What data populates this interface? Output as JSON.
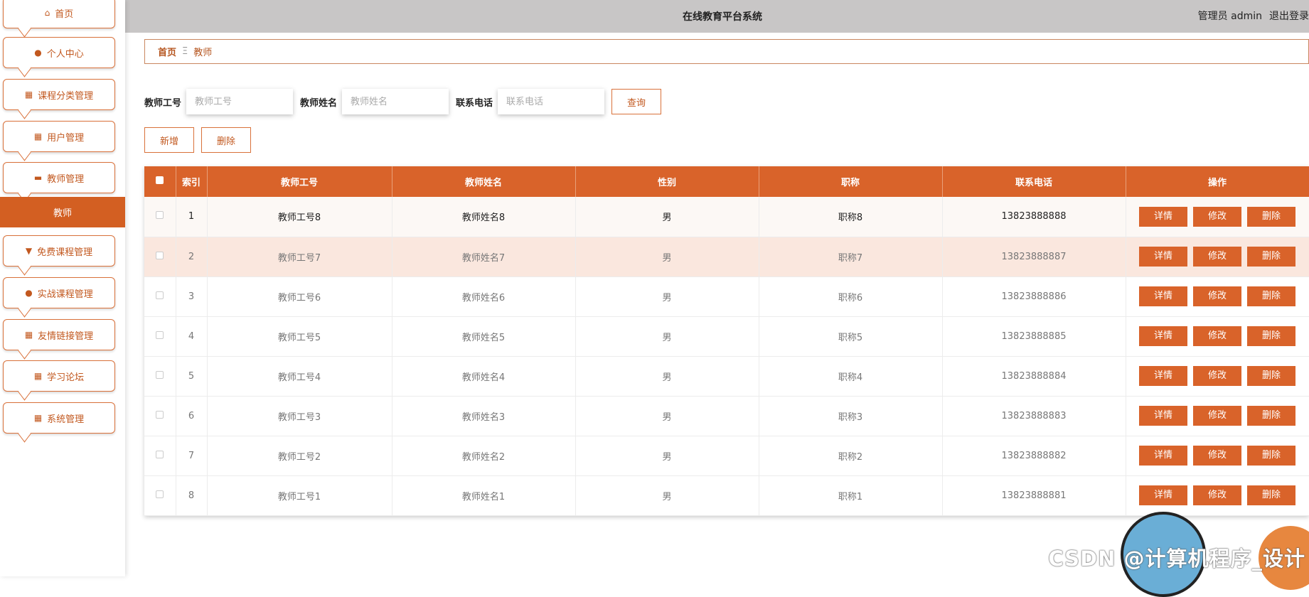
{
  "app": {
    "title": "在线教育平台系统"
  },
  "user": {
    "role_label": "管理员 admin",
    "logout": "退出登录"
  },
  "sidebar": {
    "items": [
      {
        "label": "首页",
        "icon": "home-icon",
        "glyph": "⌂"
      },
      {
        "label": "个人中心",
        "icon": "person-icon",
        "glyph": "●"
      },
      {
        "label": "课程分类管理",
        "icon": "grid-icon",
        "glyph": "▦"
      },
      {
        "label": "用户管理",
        "icon": "grid-icon",
        "glyph": "▦"
      },
      {
        "label": "教师管理",
        "icon": "briefcase-icon",
        "glyph": "▬"
      }
    ],
    "active_sub": "教师",
    "items_after": [
      {
        "label": "免费课程管理",
        "icon": "pin-icon",
        "glyph": "▼"
      },
      {
        "label": "实战课程管理",
        "icon": "person-icon",
        "glyph": "●"
      },
      {
        "label": "友情链接管理",
        "icon": "grid-icon",
        "glyph": "▦"
      },
      {
        "label": "学习论坛",
        "icon": "grid-icon",
        "glyph": "▦"
      },
      {
        "label": "系统管理",
        "icon": "grid-icon",
        "glyph": "▦"
      }
    ]
  },
  "breadcrumb": {
    "home": "首页",
    "separator": "Ξ",
    "current": "教师"
  },
  "search": {
    "fields": [
      {
        "label": "教师工号",
        "placeholder": "教师工号"
      },
      {
        "label": "教师姓名",
        "placeholder": "教师姓名"
      },
      {
        "label": "联系电话",
        "placeholder": "联系电话"
      }
    ],
    "query_label": "查询"
  },
  "actions": {
    "add_label": "新增",
    "delete_label": "删除"
  },
  "table": {
    "headers": [
      "索引",
      "教师工号",
      "教师姓名",
      "性别",
      "职称",
      "联系电话",
      "操作"
    ],
    "row_buttons": {
      "detail": "详情",
      "edit": "修改",
      "delete": "删除"
    },
    "rows": [
      {
        "index": "1",
        "id": "教师工号8",
        "name": "教师姓名8",
        "gender": "男",
        "title": "职称8",
        "phone": "13823888888"
      },
      {
        "index": "2",
        "id": "教师工号7",
        "name": "教师姓名7",
        "gender": "男",
        "title": "职称7",
        "phone": "13823888887"
      },
      {
        "index": "3",
        "id": "教师工号6",
        "name": "教师姓名6",
        "gender": "男",
        "title": "职称6",
        "phone": "13823888886"
      },
      {
        "index": "4",
        "id": "教师工号5",
        "name": "教师姓名5",
        "gender": "男",
        "title": "职称5",
        "phone": "13823888885"
      },
      {
        "index": "5",
        "id": "教师工号4",
        "name": "教师姓名4",
        "gender": "男",
        "title": "职称4",
        "phone": "13823888884"
      },
      {
        "index": "6",
        "id": "教师工号3",
        "name": "教师姓名3",
        "gender": "男",
        "title": "职称3",
        "phone": "13823888883"
      },
      {
        "index": "7",
        "id": "教师工号2",
        "name": "教师姓名2",
        "gender": "男",
        "title": "职称2",
        "phone": "13823888882"
      },
      {
        "index": "8",
        "id": "教师工号1",
        "name": "教师姓名1",
        "gender": "男",
        "title": "职称1",
        "phone": "13823888881"
      }
    ]
  },
  "watermark": "CSDN @计算机程序_设计",
  "colors": {
    "accent": "#d9632a",
    "accent_dark": "#c2581f",
    "header_bg": "#c8c6c6",
    "hover_row": "#fae7de"
  }
}
